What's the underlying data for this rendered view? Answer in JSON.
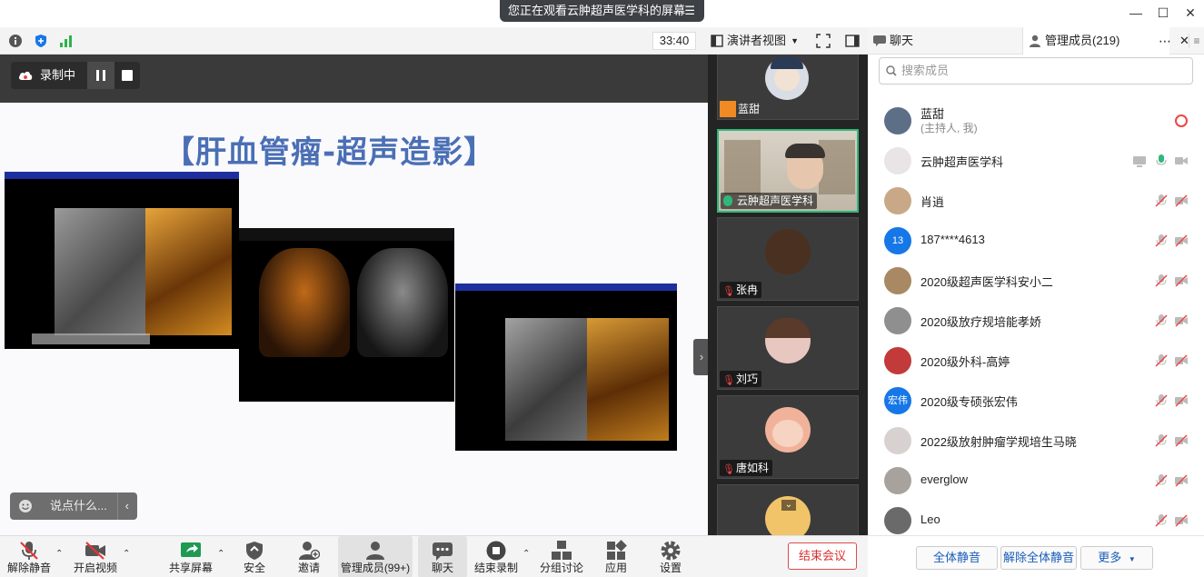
{
  "banner": {
    "text": "您正在观看云肿超声医学科的屏幕"
  },
  "toolbar": {
    "timer": "33:40",
    "view_mode": "演讲者视图"
  },
  "tabs": {
    "chat": "聊天",
    "members": "管理成员(219)"
  },
  "recording": {
    "label": "录制中"
  },
  "slide": {
    "title": "【肝血管瘤-超声造影】"
  },
  "comment": {
    "placeholder": "说点什么..."
  },
  "gallery": [
    {
      "name": "蓝甜"
    },
    {
      "name": "云肿超声医学科"
    },
    {
      "name": "张冉"
    },
    {
      "name": "刘巧"
    },
    {
      "name": "唐如科"
    }
  ],
  "members_panel": {
    "search_placeholder": "搜索成员",
    "members": [
      {
        "name": "蓝甜",
        "sub": "(主持人, 我)",
        "avatar_color": "#5d6f86"
      },
      {
        "name": "云肿超声医学科",
        "avatar_color": "#e9e4e6"
      },
      {
        "name": "肖逍",
        "avatar_color": "#c9a887"
      },
      {
        "name": "187****4613",
        "avatar_text": "13",
        "avatar_color": "#1677e8"
      },
      {
        "name": "2020级超声医学科安小二",
        "avatar_color": "#a88963"
      },
      {
        "name": "2020级放疗规培能孝娇",
        "avatar_color": "#8f8f8f"
      },
      {
        "name": "2020级外科-高婷",
        "avatar_color": "#c23a3a"
      },
      {
        "name": "2020级专硕张宏伟",
        "avatar_text": "宏伟",
        "avatar_color": "#1677e8"
      },
      {
        "name": "2022级放射肿瘤学规培生马晓",
        "avatar_color": "#d7d2cf"
      },
      {
        "name": "everglow",
        "avatar_color": "#a7a39c"
      },
      {
        "name": "Leo",
        "avatar_color": "#6a6a6a"
      }
    ],
    "bulk": {
      "mute_all": "全体静音",
      "unmute_all": "解除全体静音",
      "more": "更多"
    }
  },
  "controls": {
    "unmute": "解除静音",
    "start_video": "开启视频",
    "share": "共享屏幕",
    "security": "安全",
    "invite": "邀请",
    "manage_members": "管理成员(99+)",
    "chat": "聊天",
    "end_recording": "结束录制",
    "breakout": "分组讨论",
    "apps": "应用",
    "settings": "设置",
    "end_meeting": "结束会议"
  },
  "colors": {
    "accent": "#1677e8",
    "danger": "#d93030",
    "active_speaker": "#2fb87a",
    "slide_title": "#4a6fb5"
  }
}
